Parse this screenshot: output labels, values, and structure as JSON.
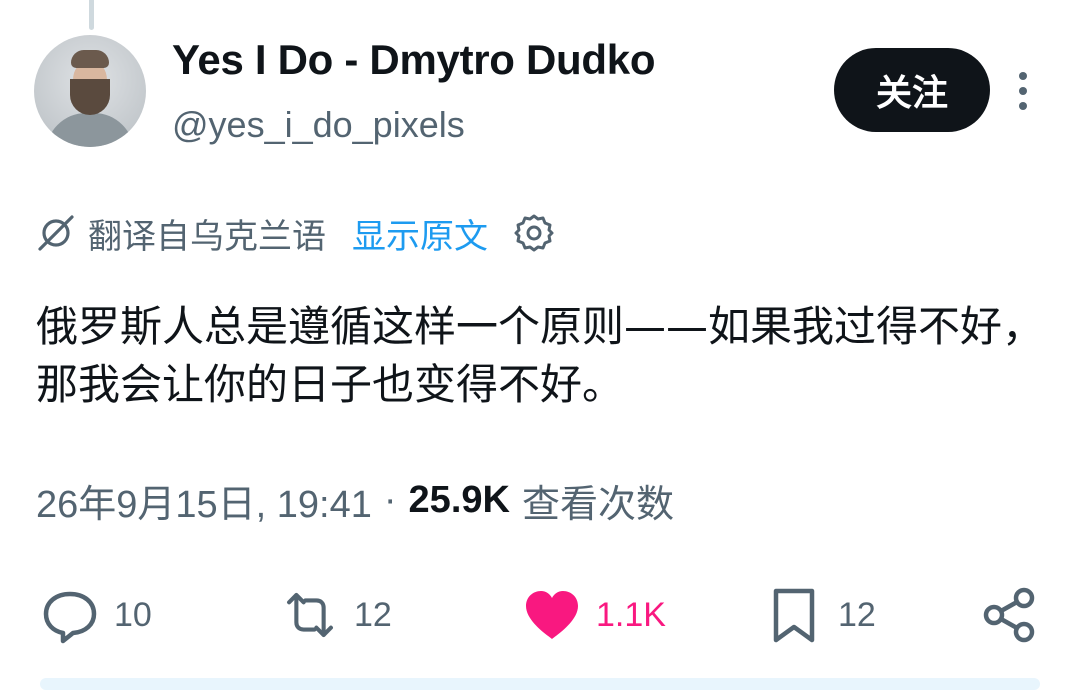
{
  "author": {
    "display_name": "Yes I Do - Dmytro Dudko",
    "handle": "@yes_i_do_pixels"
  },
  "follow_button_label": "关注",
  "translation": {
    "label": "翻译自乌克兰语",
    "show_original_label": "显示原文"
  },
  "tweet": {
    "text": "俄罗斯人总是遵循这样一个原则——如果我过得不好，那我会让你的日子也变得不好。",
    "timestamp": "26年9月15日, 19:41",
    "separator": "·",
    "views_count": "25.9K",
    "views_label": "查看次数"
  },
  "actions": {
    "replies": "10",
    "reposts": "12",
    "likes": "1.1K",
    "bookmarks": "12"
  },
  "icons": [
    "reply-icon",
    "repost-icon",
    "like-icon",
    "bookmark-icon",
    "share-icon",
    "translate-icon",
    "settings-icon",
    "more-icon"
  ],
  "colors": {
    "text_primary": "#0f1419",
    "text_secondary": "#536471",
    "link": "#1d9bf0",
    "like": "#f91880",
    "follow_bg": "#0f1419"
  }
}
